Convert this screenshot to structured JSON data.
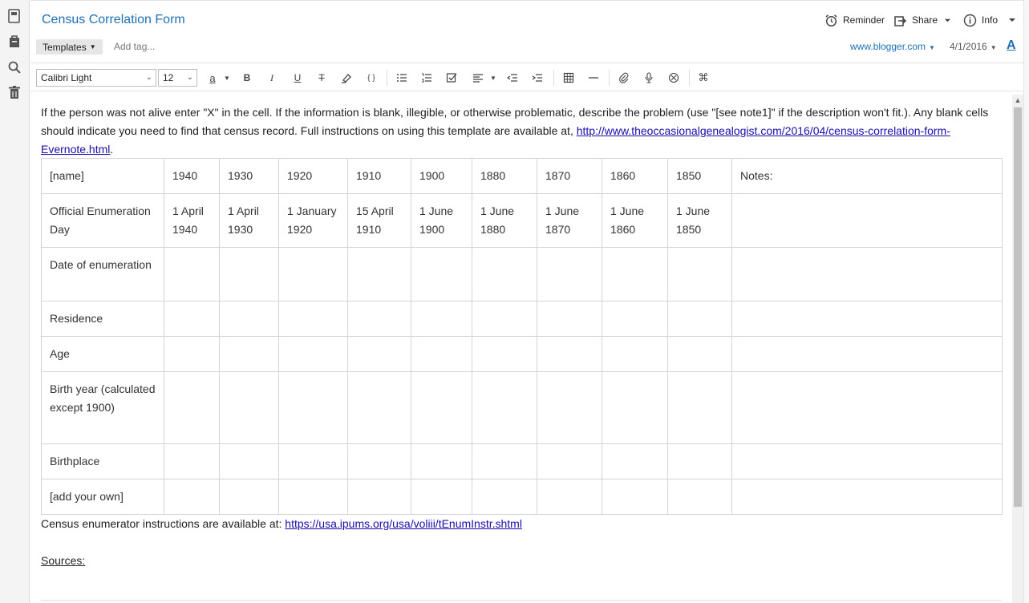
{
  "rail": {
    "icons": [
      "notes-icon",
      "notebook-icon",
      "search-icon",
      "trash-icon"
    ]
  },
  "header": {
    "title": "Census Correlation Form",
    "reminder_label": "Reminder",
    "share_label": "Share",
    "info_label": "Info"
  },
  "tagrow": {
    "templates_label": "Templates",
    "add_tag_placeholder": "Add tag...",
    "source_url": "www.blogger.com",
    "date": "4/1/2016",
    "font_color_glyph": "A"
  },
  "toolbar": {
    "font_family": "Calibri Light",
    "font_size": "12",
    "text_color_glyph": "a",
    "bold_glyph": "B",
    "italic_glyph": "I",
    "underline_glyph": "U",
    "strike_glyph": "T",
    "code_glyph": "{ }",
    "cmd_glyph": "⌘"
  },
  "editor": {
    "intro_text": "If the person was not alive enter \"X\" in the cell. If the information is blank, illegible, or otherwise problematic, describe the problem (use \"[see note1]\" if the description won't fit.). Any blank cells should indicate you need to find that census record. Full instructions on using this template are available at, ",
    "intro_link": "http://www.theoccasionalgenealogist.com/2016/04/census-correlation-form-Evernote.html",
    "intro_end": ".",
    "enum_text": "Census enumerator instructions are available at: ",
    "enum_link": "https://usa.ipums.org/usa/voliii/tEnumInstr.shtml",
    "sources_label": "Sources:"
  },
  "table": {
    "header": [
      "[name]",
      "1940",
      "1930",
      "1920",
      "1910",
      "1900",
      "1880",
      "1870",
      "1860",
      "1850",
      "Notes:"
    ],
    "rows": [
      [
        "Official Enumeration Day",
        "1 April 1940",
        "1 April 1930",
        "1 January 1920",
        "15 April 1910",
        "1 June 1900",
        "1 June 1880",
        "1 June 1870",
        "1 June 1860",
        "1 June 1850",
        ""
      ],
      [
        "Date of enumeration",
        "",
        "",
        "",
        "",
        "",
        "",
        "",
        "",
        "",
        ""
      ],
      [
        "Residence",
        "",
        "",
        "",
        "",
        "",
        "",
        "",
        "",
        "",
        ""
      ],
      [
        "Age",
        "",
        "",
        "",
        "",
        "",
        "",
        "",
        "",
        "",
        ""
      ],
      [
        "Birth year (calculated except 1900)",
        "",
        "",
        "",
        "",
        "",
        "",
        "",
        "",
        "",
        ""
      ],
      [
        "Birthplace",
        "",
        "",
        "",
        "",
        "",
        "",
        "",
        "",
        "",
        ""
      ],
      [
        "[add your own]",
        "",
        "",
        "",
        "",
        "",
        "",
        "",
        "",
        "",
        ""
      ]
    ]
  },
  "colors": {
    "title_blue": "#1f6fb5",
    "link_blue": "#1a0dab",
    "accent_green": "#2dbe60"
  }
}
